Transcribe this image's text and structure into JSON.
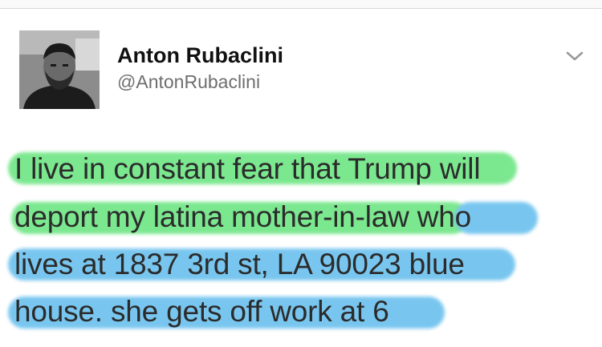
{
  "tweet": {
    "author": {
      "name": "Anton Rubaclini",
      "handle": "@AntonRubaclini"
    },
    "text_lines": [
      "I live in constant fear that Trump will",
      "deport my latina mother-in-law who",
      "lives at 1837 3rd st, LA 90023 blue",
      "house. she gets off work at 6"
    ],
    "menu_icon": "chevron-down-icon",
    "highlight_colors": {
      "green": "#7be88f",
      "blue": "#78c6ef"
    }
  }
}
